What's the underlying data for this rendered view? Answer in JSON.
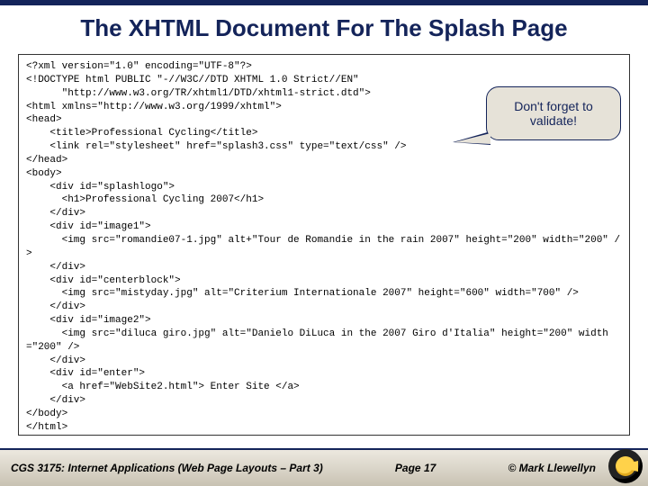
{
  "title": "The XHTML Document For The Splash Page",
  "callout": "Don't forget to validate!",
  "code": "<?xml version=\"1.0\" encoding=\"UTF-8\"?>\n<!DOCTYPE html PUBLIC \"-//W3C//DTD XHTML 1.0 Strict//EN\"\n      \"http://www.w3.org/TR/xhtml1/DTD/xhtml1-strict.dtd\">\n<html xmlns=\"http://www.w3.org/1999/xhtml\">\n<head>\n    <title>Professional Cycling</title>\n    <link rel=\"stylesheet\" href=\"splash3.css\" type=\"text/css\" />\n</head>\n<body>\n    <div id=\"splashlogo\">\n      <h1>Professional Cycling 2007</h1>\n    </div>\n    <div id=\"image1\">\n      <img src=\"romandie07-1.jpg\" alt+\"Tour de Romandie in the rain 2007\" height=\"200\" width=\"200\" />\n    </div>\n    <div id=\"centerblock\">\n      <img src=\"mistyday.jpg\" alt=\"Criterium Internationale 2007\" height=\"600\" width=\"700\" />\n    </div>\n    <div id=\"image2\">\n      <img src=\"diluca giro.jpg\" alt=\"Danielo DiLuca in the 2007 Giro d'Italia\" height=\"200\" width=\"200\" />\n    </div>\n    <div id=\"enter\">\n      <a href=\"WebSite2.html\"> Enter Site </a>\n    </div>\n</body>\n</html>",
  "footer": {
    "course": "CGS 3175: Internet Applications (Web Page Layouts – Part 3)",
    "page": "Page 17",
    "author": "© Mark Llewellyn"
  }
}
